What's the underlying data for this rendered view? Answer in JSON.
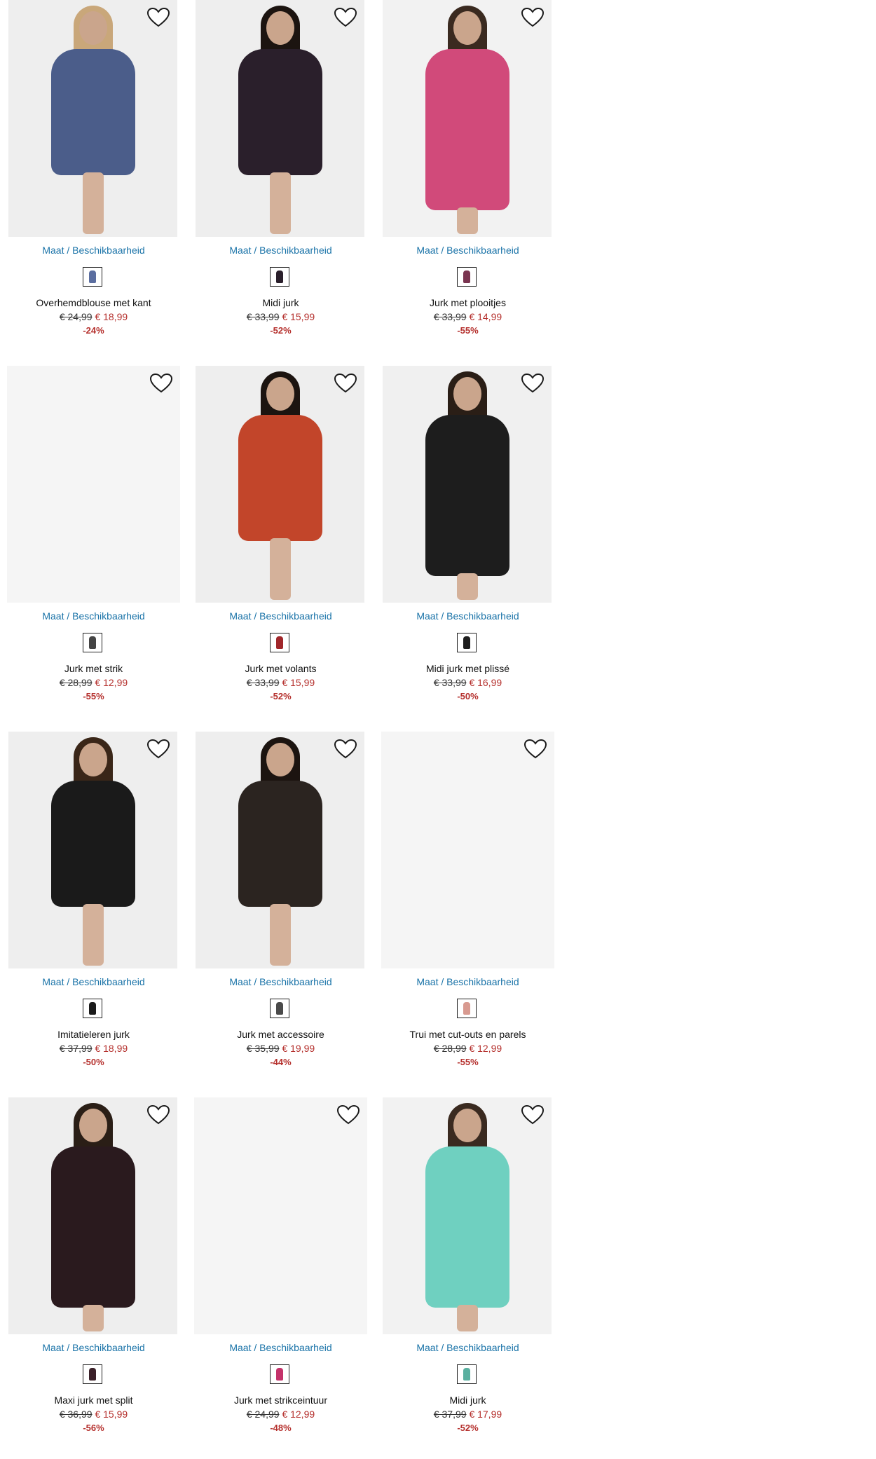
{
  "products": [
    {
      "size_link": "Maat / Beschikbaarheid",
      "name": "Overhemdblouse met kant",
      "old_price": "€ 24,99",
      "new_price": "€ 18,99",
      "discount": "-24%",
      "colors": {
        "dress": "#4b5d8a",
        "swatch": "#5b6ea0",
        "bg": "#eeeeee"
      },
      "hair": "#c9a77a",
      "has_image": true
    },
    {
      "size_link": "Maat / Beschikbaarheid",
      "name": "Midi jurk",
      "old_price": "€ 33,99",
      "new_price": "€ 15,99",
      "discount": "-52%",
      "colors": {
        "dress": "#2a1f2b",
        "swatch": "#2a1f2b",
        "bg": "#eeeeee"
      },
      "hair": "#1c1410",
      "has_image": true
    },
    {
      "size_link": "Maat / Beschikbaarheid",
      "name": "Jurk met plooitjes",
      "old_price": "€ 33,99",
      "new_price": "€ 14,99",
      "discount": "-55%",
      "colors": {
        "dress": "#d14a7a",
        "swatch": "#7a3450",
        "bg": "#f2f2f2"
      },
      "hair": "#3a2a20",
      "has_image": true
    },
    {
      "size_link": "Maat / Beschikbaarheid",
      "name": "Jurk met strik",
      "old_price": "€ 28,99",
      "new_price": "€ 12,99",
      "discount": "-55%",
      "colors": {
        "dress": "#444444",
        "swatch": "#444444",
        "bg": "#f5f5f5"
      },
      "hair": "#000000",
      "has_image": false
    },
    {
      "size_link": "Maat / Beschikbaarheid",
      "name": "Jurk met volants",
      "old_price": "€ 33,99",
      "new_price": "€ 15,99",
      "discount": "-52%",
      "colors": {
        "dress": "#c2452a",
        "swatch": "#a0262a",
        "bg": "#eeeeee"
      },
      "hair": "#1c1410",
      "has_image": true
    },
    {
      "size_link": "Maat / Beschikbaarheid",
      "name": "Midi jurk met plissé",
      "old_price": "€ 33,99",
      "new_price": "€ 16,99",
      "discount": "-50%",
      "colors": {
        "dress": "#1d1d1d",
        "swatch": "#1d1d1d",
        "bg": "#f0f0f0"
      },
      "hair": "#2a1e16",
      "has_image": true
    },
    {
      "size_link": "Maat / Beschikbaarheid",
      "name": "Imitatieleren jurk",
      "old_price": "€ 37,99",
      "new_price": "€ 18,99",
      "discount": "-50%",
      "colors": {
        "dress": "#1a1a1a",
        "swatch": "#1a1a1a",
        "bg": "#eeeeee"
      },
      "hair": "#3a2618",
      "has_image": true
    },
    {
      "size_link": "Maat / Beschikbaarheid",
      "name": "Jurk met accessoire",
      "old_price": "€ 35,99",
      "new_price": "€ 19,99",
      "discount": "-44%",
      "colors": {
        "dress": "#2b2420",
        "swatch": "#4a4a4a",
        "bg": "#eeeeee"
      },
      "hair": "#1c1410",
      "has_image": true
    },
    {
      "size_link": "Maat / Beschikbaarheid",
      "name": "Trui met cut-outs en parels",
      "old_price": "€ 28,99",
      "new_price": "€ 12,99",
      "discount": "-55%",
      "colors": {
        "dress": "#d89a90",
        "swatch": "#d89a90",
        "bg": "#f5f5f5"
      },
      "hair": "#000000",
      "has_image": false
    },
    {
      "size_link": "Maat / Beschikbaarheid",
      "name": "Maxi jurk met split",
      "old_price": "€ 36,99",
      "new_price": "€ 15,99",
      "discount": "-56%",
      "colors": {
        "dress": "#2a1a1e",
        "swatch": "#3a2028",
        "bg": "#eeeeee"
      },
      "hair": "#2a1e16",
      "has_image": true
    },
    {
      "size_link": "Maat / Beschikbaarheid",
      "name": "Jurk met strikceintuur",
      "old_price": "€ 24,99",
      "new_price": "€ 12,99",
      "discount": "-48%",
      "colors": {
        "dress": "#c4326a",
        "swatch": "#c4326a",
        "bg": "#f5f5f5"
      },
      "hair": "#000000",
      "has_image": false
    },
    {
      "size_link": "Maat / Beschikbaarheid",
      "name": "Midi jurk",
      "old_price": "€ 37,99",
      "new_price": "€ 17,99",
      "discount": "-52%",
      "colors": {
        "dress": "#6fd0c0",
        "swatch": "#5ab0a0",
        "bg": "#f2f2f2"
      },
      "hair": "#3a2a20",
      "has_image": true
    }
  ]
}
